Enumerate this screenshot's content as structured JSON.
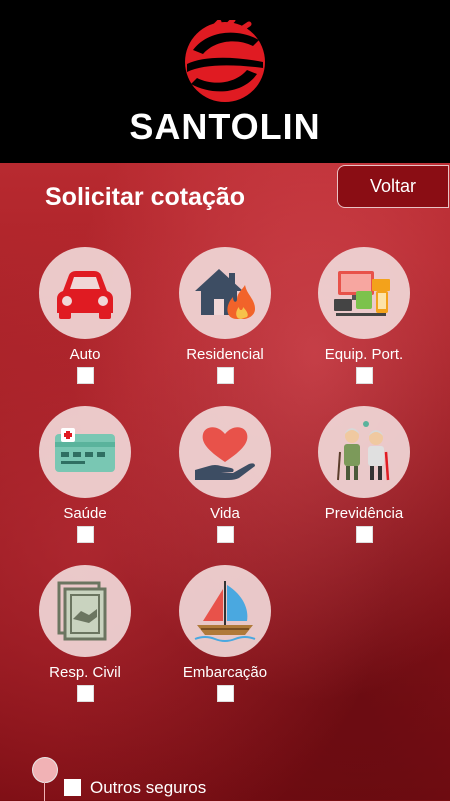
{
  "brand": {
    "name": "SANTOLIN"
  },
  "page": {
    "title": "Solicitar cotação",
    "back_label": "Voltar"
  },
  "options": [
    {
      "label": "Auto",
      "icon": "car-icon",
      "checked": false
    },
    {
      "label": "Residencial",
      "icon": "house-fire-icon",
      "checked": false
    },
    {
      "label": "Equip. Port.",
      "icon": "devices-icon",
      "checked": false
    },
    {
      "label": "Saúde",
      "icon": "health-card-icon",
      "checked": false
    },
    {
      "label": "Vida",
      "icon": "heart-hand-icon",
      "checked": false
    },
    {
      "label": "Previdência",
      "icon": "elderly-couple-icon",
      "checked": false
    },
    {
      "label": "Resp. Civil",
      "icon": "handshake-document-icon",
      "checked": false
    },
    {
      "label": "Embarcação",
      "icon": "sailboat-icon",
      "checked": false
    }
  ],
  "other": {
    "label": "Outros seguros",
    "checked": false
  },
  "colors": {
    "brand_red": "#e01b22",
    "header_bg": "#000000",
    "back_button_bg": "#8a0d14"
  }
}
